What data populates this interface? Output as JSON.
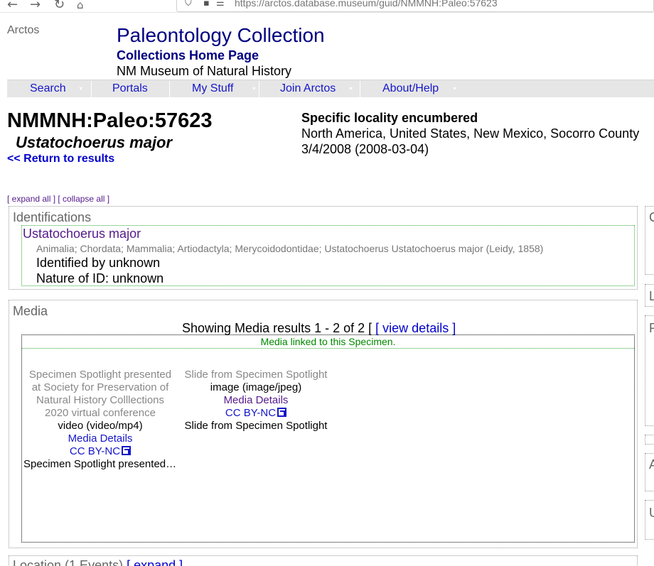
{
  "browser": {
    "url": "https://arctos.database.museum/guid/NMMNH:Paleo:57623"
  },
  "header": {
    "site_name": "Arctos",
    "collection_title": "Paleontology Collection",
    "collections_home": "Collections Home Page",
    "museum": "NM Museum of Natural History"
  },
  "menu": {
    "items": [
      {
        "label": "Search"
      },
      {
        "label": "Portals"
      },
      {
        "label": "My Stuff"
      },
      {
        "label": "Join Arctos"
      },
      {
        "label": "About/Help"
      }
    ]
  },
  "record": {
    "guid": "NMMNH:Paleo:57623",
    "scientific_name": "Ustatochoerus major",
    "return_link": "<< Return to results",
    "locality_title": "Specific locality encumbered",
    "locality_geo": "North America, United States, New Mexico, Socorro County",
    "date": "3/4/2008 (2008-03-04)"
  },
  "expand_links": {
    "expand": "[ expand all ]",
    "collapse": "[ collapse all ]"
  },
  "identifications": {
    "title": "Identifications",
    "name": "Ustatochoerus major",
    "taxonomy": "Animalia; Chordata; Mammalia; Artiodactyla; Merycoidodontidae; Ustatochoerus Ustatochoerus major (Leidy, 1858)",
    "identified_by": "Identified by unknown",
    "nature_of_id": "Nature of ID: unknown"
  },
  "media": {
    "title": "Media",
    "showing": "Showing Media results 1 - 2 of 2 [",
    "view_details": "[ view details ]",
    "linked_label": "Media linked to this Specimen.",
    "items": [
      {
        "description": "Specimen Spotlight presented at Society for Preservation of Natural History Colllections 2020 virtual conference",
        "mime": "video (video/mp4)",
        "details": "Media Details",
        "license": "CC BY-NC",
        "caption": "Specimen Spotlight presented at Society for Preservation of Natural History Colllections 2020 virtual conference"
      },
      {
        "description": "Slide from Specimen Spotlight",
        "mime": "image (image/jpeg)",
        "details": "Media Details",
        "license": "CC BY-NC",
        "caption": "Slide from Specimen Spotlight"
      }
    ]
  },
  "right_column": {
    "letters": [
      "C",
      "L",
      "P",
      "A",
      "U"
    ]
  },
  "location": {
    "title": "Location (1 Events)",
    "expand": "[ expand ]"
  }
}
